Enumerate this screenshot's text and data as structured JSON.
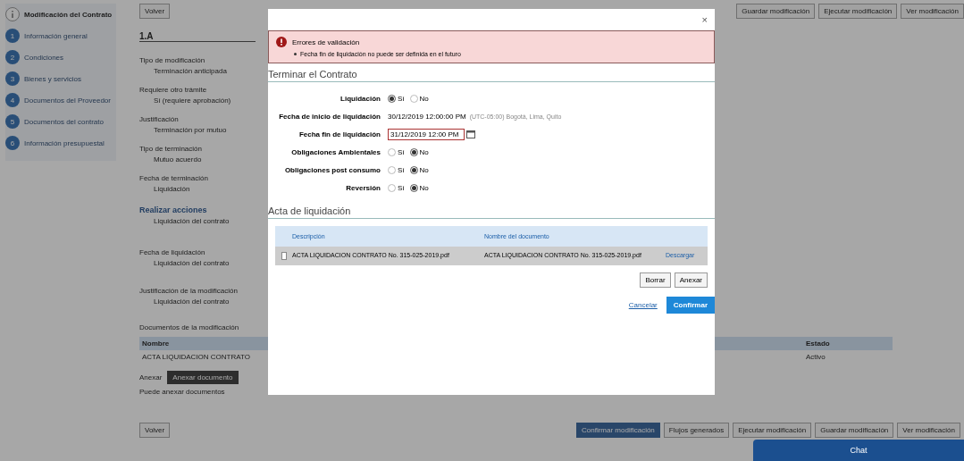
{
  "sidebar": {
    "title": "Modificación del Contrato",
    "steps": [
      {
        "number": "1",
        "label": "Información general"
      },
      {
        "number": "2",
        "label": "Condiciones"
      },
      {
        "number": "3",
        "label": "Bienes y servicios"
      },
      {
        "number": "4",
        "label": "Documentos del Proveedor"
      },
      {
        "number": "5",
        "label": "Documentos del contrato"
      },
      {
        "number": "6",
        "label": "Información presupuestal"
      }
    ]
  },
  "top_toolbar": [
    "Guardar modificación",
    "Ejecutar modificación",
    "Ver modificación"
  ],
  "main": {
    "back_button": "Volver",
    "section": "1.A",
    "fields": [
      {
        "label": "Tipo de modificación",
        "value": "Terminación anticipada"
      },
      {
        "label": "Requiere otro trámite",
        "value": "Sí (requiere aprobación)"
      },
      {
        "label": "Justificación",
        "value": "Terminación por mutuo"
      },
      {
        "label": "Tipo de terminación",
        "value": "Mutuo acuerdo"
      },
      {
        "label": "Fecha de terminación",
        "value": "Liquidación"
      }
    ],
    "link": "Realizar acciones",
    "link_note": "Liquidación del contrato",
    "extra_label": "Fecha de liquidación",
    "extra_value": "Liquidación del contrato",
    "summary_label": "Justificación de la modificación",
    "summary_value": "Liquidación del contrato",
    "docs_label": "Documentos de la modificación",
    "docs_columns": [
      "Nombre",
      "Estado"
    ],
    "docs_rows": [
      [
        "ACTA LIQUIDACION CONTRATO",
        "Activo"
      ]
    ],
    "attach_label": "Anexar",
    "attach_button": "Anexar documento",
    "attach_note": "Puede anexar documentos",
    "back_button_bottom": "Volver"
  },
  "bottom_toolbar": [
    {
      "label": "Confirmar modificación",
      "primary": true
    },
    {
      "label": "Flujos generados",
      "primary": false
    },
    {
      "label": "Ejecutar modificación",
      "primary": false
    },
    {
      "label": "Guardar modificación",
      "primary": false
    },
    {
      "label": "Ver modificación",
      "primary": false
    }
  ],
  "chat_bar": "Chat",
  "modal": {
    "close": "×",
    "alert": {
      "title": "Errores de validación",
      "items": [
        "Fecha fin de liquidación no puede ser definida en el futuro"
      ]
    },
    "section_1": "Terminar el Contrato",
    "fields": [
      {
        "kind": "radio",
        "label": "Liquidación",
        "options": [
          {
            "label": "Sí",
            "selected": true
          },
          {
            "label": "No",
            "selected": false
          }
        ]
      },
      {
        "kind": "text",
        "label": "Fecha de inicio de liquidación",
        "value": "30/12/2019 12:00:00 PM",
        "note": "(UTC-05:00) Bogotá, Lima, Quito"
      },
      {
        "kind": "date",
        "label": "Fecha fin de liquidación",
        "value": "31/12/2019 12:00 PM"
      },
      {
        "kind": "radio",
        "label": "Obligaciones Ambientales",
        "options": [
          {
            "label": "Sí",
            "selected": false
          },
          {
            "label": "No",
            "selected": true
          }
        ]
      },
      {
        "kind": "radio",
        "label": "Obligaciones post consumo",
        "options": [
          {
            "label": "Sí",
            "selected": false
          },
          {
            "label": "No",
            "selected": true
          }
        ]
      },
      {
        "kind": "radio",
        "label": "Reversión",
        "options": [
          {
            "label": "Sí",
            "selected": false
          },
          {
            "label": "No",
            "selected": true
          }
        ]
      }
    ],
    "section_2": "Acta de liquidación",
    "columns": [
      "Descripción",
      "Nombre del documento"
    ],
    "rows": [
      {
        "description": "ACTA LIQUIDACION CONTRATO No. 315-025-2019.pdf",
        "file": "ACTA LIQUIDACION CONTRATO No. 315-025-2019.pdf",
        "action": "Descargar",
        "selected": false
      }
    ],
    "table_buttons": [
      "Borrar",
      "Anexar"
    ],
    "cancel": "Cancelar",
    "confirm": "Confirmar"
  }
}
